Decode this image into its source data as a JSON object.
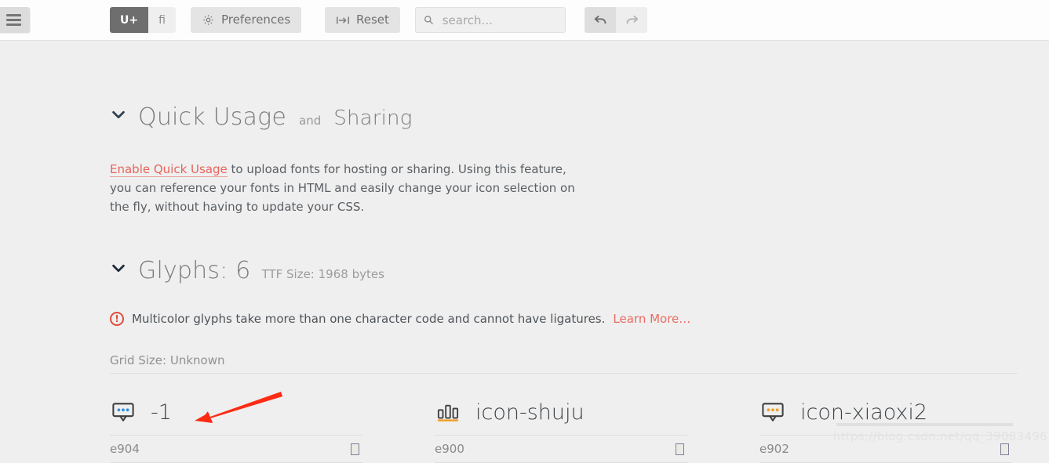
{
  "toolbar": {
    "menu_icon": "hamburger-icon",
    "segments": [
      {
        "label": "U+",
        "name": "unicode-toggle",
        "active": true
      },
      {
        "label": "fi",
        "name": "ligature-toggle",
        "active": false
      }
    ],
    "preferences": {
      "label": "Preferences",
      "icon": "gear-icon"
    },
    "reset": {
      "label": "Reset",
      "icon": "tab-arrow-icon"
    },
    "search": {
      "value": "",
      "placeholder": "search...",
      "icon": "search-icon"
    },
    "undo": {
      "icon": "undo-arrow-icon"
    },
    "redo": {
      "icon": "redo-arrow-icon"
    }
  },
  "quick_usage": {
    "chevron": "chevron-down-icon",
    "title": "Quick Usage",
    "conjunction": "and",
    "subtitle": "Sharing",
    "link": "Enable Quick Usage",
    "body": " to upload fonts for hosting or sharing. Using this feature, you can reference your fonts in HTML and easily change your icon selection on the fly, without having to update your CSS."
  },
  "glyphs_section": {
    "chevron": "chevron-down-icon",
    "title": "Glyphs: 6",
    "ttf_size": "TTF Size: 1968 bytes",
    "notice_icon": "info-circle-icon",
    "notice_text": "Multicolor glyphs take more than one character code and cannot have ligatures.",
    "notice_link": "Learn More…",
    "grid_size": "Grid Size: Unknown"
  },
  "glyphs": [
    {
      "icon": "speech-bubble-dots-icon",
      "name": "-1",
      "code": "e904",
      "dot_color": "#2f8fe0",
      "outline_color": "#3f3f3f"
    },
    {
      "icon": "bar-chart-icon",
      "name": "icon-shuju",
      "code": "e900",
      "dot_color": "#f0a022",
      "outline_color": "#3f3f3f"
    },
    {
      "icon": "speech-bubble-dots-icon",
      "name": "icon-xiaoxi2",
      "code": "e902",
      "dot_color": "#f0a022",
      "outline_color": "#3f3f3f"
    }
  ],
  "annotation": {
    "type": "red-arrow",
    "color": "#fc2b13"
  },
  "watermark": {
    "text": "https://blog.csdn.net/qq_39083496"
  },
  "colors": {
    "toolbar_bg": "#fdfdfd",
    "body_bg": "#efefef",
    "accent_red": "#e8635a",
    "accent_orange": "#f0a022"
  }
}
